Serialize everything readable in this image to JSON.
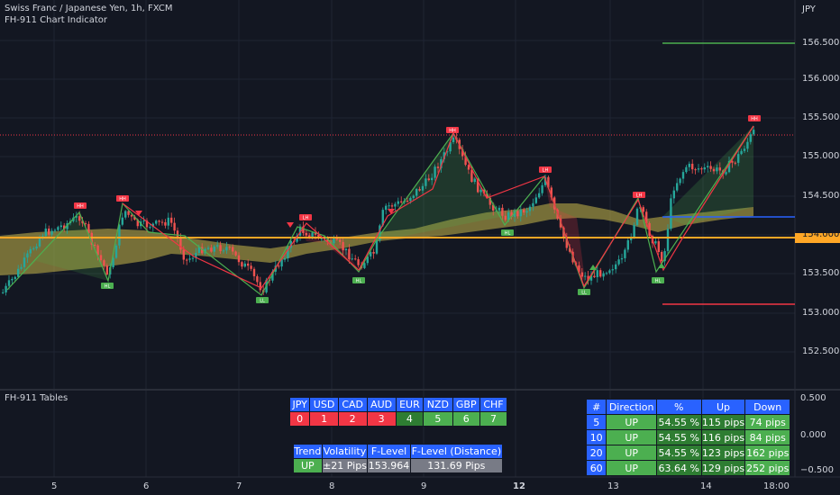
{
  "header": {
    "symbol": "Swiss Franc / Japanese Yen, 1h, FXCM",
    "indicator": "FH-911 Chart Indicator",
    "currency": "JPY",
    "pane2_title": "FH-911 Tables"
  },
  "price_axis": [
    "156.500",
    "156.000",
    "155.500",
    "155.000",
    "154.500",
    "154.000",
    "153.500",
    "153.000",
    "152.500"
  ],
  "osc_axis": [
    "0.500",
    "0.000",
    "−0.500"
  ],
  "time_axis": [
    "5",
    "6",
    "7",
    "8",
    "9",
    "12",
    "13",
    "14",
    "18:00"
  ],
  "swing_labels": {
    "hh": "HH",
    "lh": "LH",
    "hl": "HL",
    "ll": "LL"
  },
  "currency_table": {
    "headers": [
      "JPY",
      "USD",
      "CAD",
      "AUD",
      "EUR",
      "NZD",
      "GBP",
      "CHF"
    ],
    "values": [
      "0",
      "1",
      "2",
      "3",
      "4",
      "5",
      "6",
      "7"
    ],
    "colors": [
      "#f23645",
      "#f23645",
      "#f23645",
      "#f23645",
      "#2e7d32",
      "#4caf50",
      "#4caf50",
      "#4caf50"
    ]
  },
  "trend_table": {
    "headers": [
      "Trend",
      "Volatility",
      "F-Level",
      "F-Level (Distance)"
    ],
    "values": [
      "UP",
      "±21 Pips",
      "153.964",
      "131.69 Pips"
    ]
  },
  "direction_table": {
    "headers": [
      "#",
      "Direction",
      "%",
      "Up",
      "Down"
    ],
    "rows": [
      [
        "5",
        "UP",
        "54.55 %",
        "115 pips",
        "74 pips"
      ],
      [
        "10",
        "UP",
        "54.55 %",
        "116 pips",
        "84 pips"
      ],
      [
        "20",
        "UP",
        "54.55 %",
        "123 pips",
        "162 pips"
      ],
      [
        "60",
        "UP",
        "63.64 %",
        "129 pips",
        "252 pips"
      ]
    ]
  },
  "colors": {
    "bull": "#26a69a",
    "bear": "#ef5350",
    "up": "#4caf50",
    "down": "#f23645",
    "header": "#2962ff",
    "fib": "#ffa726",
    "cloud": "#c9b84a"
  }
}
